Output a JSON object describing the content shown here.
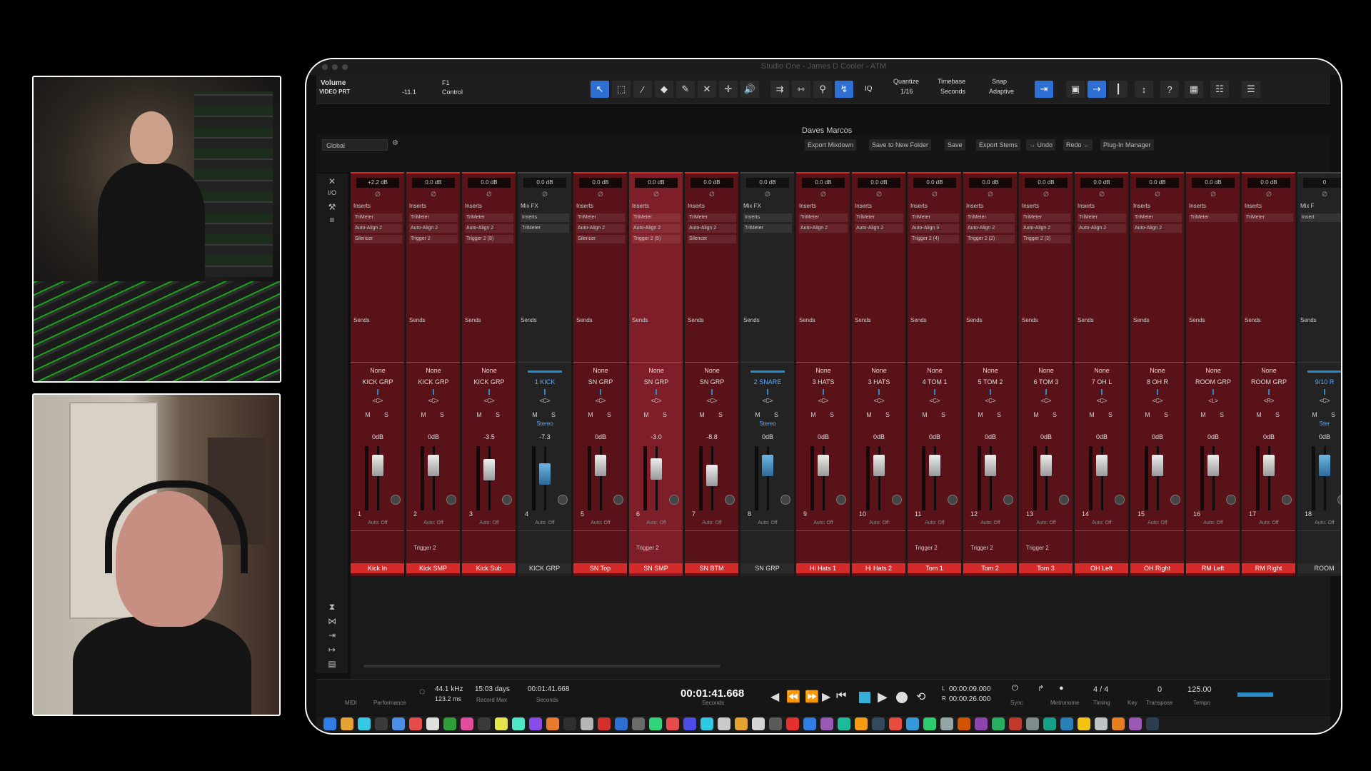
{
  "window": {
    "title": "Studio One - James D Cooler - ATM"
  },
  "toolbar": {
    "track_label": "Volume",
    "track_sub": "VIDEO PRT",
    "track_value": "-11.1",
    "control_label": "F1",
    "control_sub": "Control",
    "iq_label": "IQ",
    "quantize_label": "Quantize",
    "quantize_value": "1/16",
    "timebase_label": "Timebase",
    "timebase_value": "Seconds",
    "snap_label": "Snap",
    "snap_value": "Adaptive"
  },
  "macro": {
    "title": "Daves Marcos",
    "global_select": "Global",
    "buttons": [
      "Export Mixdown",
      "Save to New Folder",
      "Save",
      "Export Stems",
      "→ Undo",
      "Redo ←",
      "Plug-In Manager"
    ]
  },
  "rail": {
    "top_labels": [
      "I/O"
    ]
  },
  "channels": [
    {
      "num": "1",
      "name": "Kick In",
      "group": "KICK GRP",
      "route": "None",
      "gain": "+2.2 dB",
      "vol": "0dB",
      "ins_hdr": "Inserts",
      "inserts": [
        "TriMeter",
        "Auto-Align 2",
        "Silencer"
      ],
      "trigger": "",
      "kind": "red",
      "pan": "<C>",
      "sel": false
    },
    {
      "num": "2",
      "name": "Kick SMP",
      "group": "KICK GRP",
      "route": "None",
      "gain": "0.0 dB",
      "vol": "0dB",
      "ins_hdr": "Inserts",
      "inserts": [
        "TriMeter",
        "Auto-Align 2",
        "Trigger 2"
      ],
      "trigger": "Trigger 2",
      "kind": "red",
      "pan": "<C>",
      "sel": false
    },
    {
      "num": "3",
      "name": "Kick Sub",
      "group": "KICK GRP",
      "route": "None",
      "gain": "0.0 dB",
      "vol": "-3.5",
      "ins_hdr": "Inserts",
      "inserts": [
        "TriMeter",
        "Auto-Align 2",
        "Trigger 2 (8)"
      ],
      "trigger": "",
      "kind": "red",
      "pan": "<C>",
      "sel": false
    },
    {
      "num": "4",
      "name": "KICK GRP",
      "group": "1 KICK",
      "route": "",
      "gain": "0.0 dB",
      "vol": "-7.3",
      "ins_hdr": "Mix FX",
      "inserts": [
        "Inserts",
        "TriMeter"
      ],
      "trigger": "",
      "kind": "gray",
      "pan": "<C>",
      "sel": false,
      "stereo": "Stereo"
    },
    {
      "num": "5",
      "name": "SN Top",
      "group": "SN GRP",
      "route": "None",
      "gain": "0.0 dB",
      "vol": "0dB",
      "ins_hdr": "Inserts",
      "inserts": [
        "TriMeter",
        "Auto-Align 2",
        "Silencer"
      ],
      "trigger": "",
      "kind": "red",
      "pan": "<C>",
      "sel": false
    },
    {
      "num": "6",
      "name": "SN SMP",
      "group": "SN GRP",
      "route": "None",
      "gain": "0.0 dB",
      "vol": "-3.0",
      "ins_hdr": "Inserts",
      "inserts": [
        "TriMeter",
        "Auto-Align 2",
        "Trigger 2 (5)"
      ],
      "trigger": "Trigger 2",
      "kind": "red",
      "pan": "<C>",
      "sel": true
    },
    {
      "num": "7",
      "name": "SN BTM",
      "group": "SN GRP",
      "route": "None",
      "gain": "0.0 dB",
      "vol": "-8.8",
      "ins_hdr": "Inserts",
      "inserts": [
        "TriMeter",
        "Auto-Align 2",
        "Silencer"
      ],
      "trigger": "",
      "kind": "red",
      "pan": "<C>",
      "sel": false
    },
    {
      "num": "8",
      "name": "SN GRP",
      "group": "2 SNARE",
      "route": "",
      "gain": "0.0 dB",
      "vol": "0dB",
      "ins_hdr": "Mix FX",
      "inserts": [
        "Inserts",
        "TriMeter"
      ],
      "trigger": "",
      "kind": "gray",
      "pan": "<C>",
      "sel": false,
      "stereo": "Stereo"
    },
    {
      "num": "9",
      "name": "Hi Hats 1",
      "group": "3 HATS",
      "route": "None",
      "gain": "0.0 dB",
      "vol": "0dB",
      "ins_hdr": "Inserts",
      "inserts": [
        "TriMeter",
        "Auto-Align 2"
      ],
      "trigger": "",
      "kind": "red",
      "pan": "<C>",
      "sel": false
    },
    {
      "num": "10",
      "name": "Hi Hats 2",
      "group": "3 HATS",
      "route": "None",
      "gain": "0.0 dB",
      "vol": "0dB",
      "ins_hdr": "Inserts",
      "inserts": [
        "TriMeter",
        "Auto-Align 2"
      ],
      "trigger": "",
      "kind": "red",
      "pan": "<C>",
      "sel": false
    },
    {
      "num": "11",
      "name": "Tom 1",
      "group": "4 TOM 1",
      "route": "None",
      "gain": "0.0 dB",
      "vol": "0dB",
      "ins_hdr": "Inserts",
      "inserts": [
        "TriMeter",
        "Auto-Align 3",
        "Trigger 2 (4)"
      ],
      "trigger": "Trigger 2",
      "kind": "red",
      "pan": "<C>",
      "sel": false
    },
    {
      "num": "12",
      "name": "Tom 2",
      "group": "5 TOM 2",
      "route": "None",
      "gain": "0.0 dB",
      "vol": "0dB",
      "ins_hdr": "Inserts",
      "inserts": [
        "TriMeter",
        "Auto-Align 2",
        "Trigger 2 (2)"
      ],
      "trigger": "Trigger 2",
      "kind": "red",
      "pan": "<C>",
      "sel": false
    },
    {
      "num": "13",
      "name": "Tom 3",
      "group": "6 TOM 3",
      "route": "None",
      "gain": "0.0 dB",
      "vol": "0dB",
      "ins_hdr": "Inserts",
      "inserts": [
        "TriMeter",
        "Auto-Align 2",
        "Trigger 2 (3)"
      ],
      "trigger": "Trigger 2",
      "kind": "red",
      "pan": "<C>",
      "sel": false
    },
    {
      "num": "14",
      "name": "OH Left",
      "group": "7 OH L",
      "route": "None",
      "gain": "0.0 dB",
      "vol": "0dB",
      "ins_hdr": "Inserts",
      "inserts": [
        "TriMeter",
        "Auto-Align 2"
      ],
      "trigger": "",
      "kind": "red",
      "pan": "<C>",
      "sel": false
    },
    {
      "num": "15",
      "name": "OH Right",
      "group": "8 OH R",
      "route": "None",
      "gain": "0.0 dB",
      "vol": "0dB",
      "ins_hdr": "Inserts",
      "inserts": [
        "TriMeter",
        "Auto-Align 2"
      ],
      "trigger": "",
      "kind": "red",
      "pan": "<C>",
      "sel": false
    },
    {
      "num": "16",
      "name": "RM Left",
      "group": "ROOM GRP",
      "route": "None",
      "gain": "0.0 dB",
      "vol": "0dB",
      "ins_hdr": "Inserts",
      "inserts": [
        "TriMeter"
      ],
      "trigger": "",
      "kind": "red",
      "pan": "<L>",
      "sel": false
    },
    {
      "num": "17",
      "name": "RM Right",
      "group": "ROOM GRP",
      "route": "None",
      "gain": "0.0 dB",
      "vol": "0dB",
      "ins_hdr": "Inserts",
      "inserts": [
        "TriMeter"
      ],
      "trigger": "",
      "kind": "red",
      "pan": "<R>",
      "sel": false
    },
    {
      "num": "18",
      "name": "ROOM",
      "group": "9/10 R",
      "route": "",
      "gain": "0",
      "vol": "0dB",
      "ins_hdr": "Mix F",
      "inserts": [
        "Insert"
      ],
      "trigger": "",
      "kind": "gray",
      "pan": "<C>",
      "sel": false,
      "stereo": "Ster"
    }
  ],
  "labels": {
    "sends": "Sends",
    "mute": "M",
    "solo": "S",
    "auto": "Auto: Off"
  },
  "transport": {
    "midi": "MIDI",
    "performance": "Performance",
    "sample_rate": "44.1 kHz",
    "latency": "123.2 ms",
    "record_days": "15:03 days",
    "record_max": "Record Max",
    "time_small": "00:01:41.668",
    "time_small_sub": "Seconds",
    "time_main": "00:01:41.668",
    "time_main_sub": "Seconds",
    "loop_start": "00:00:09.000",
    "loop_end": "00:00:26.000",
    "L": "L",
    "R": "R",
    "sync": "Sync",
    "metronome": "Metronome",
    "timing_value": "4 / 4",
    "timing": "Timing",
    "key": "Key",
    "transpose_value": "0",
    "transpose": "Transpose",
    "tempo_value": "125.00",
    "tempo": "Tempo"
  },
  "colors": {
    "track_red": "#d42a2a",
    "accent_blue": "#2e6fd4",
    "stop_cyan": "#35b0d8"
  }
}
